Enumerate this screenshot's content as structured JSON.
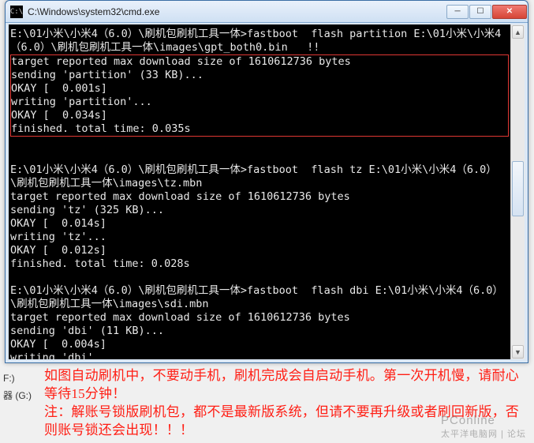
{
  "window": {
    "title": "C:\\Windows\\system32\\cmd.exe",
    "icon_label": "C:\\"
  },
  "console": {
    "block1_cmd": "E:\\01小米\\小米4（6.0）\\刷机包刷机工具一体>fastboot  flash partition E:\\01小米\\小米4（6.0）\\刷机包刷机工具一体\\images\\gpt_both0.bin   !!",
    "block1_hl": "target reported max download size of 1610612736 bytes\nsending 'partition' (33 KB)...\nOKAY [  0.001s]\nwriting 'partition'...\nOKAY [  0.034s]\nfinished. total time: 0.035s",
    "blank1": "",
    "block2": "E:\\01小米\\小米4（6.0）\\刷机包刷机工具一体>fastboot  flash tz E:\\01小米\\小米4（6.0）\\刷机包刷机工具一体\\images\\tz.mbn\ntarget reported max download size of 1610612736 bytes\nsending 'tz' (325 KB)...\nOKAY [  0.014s]\nwriting 'tz'...\nOKAY [  0.012s]\nfinished. total time: 0.028s",
    "blank2": "",
    "block3": "E:\\01小米\\小米4（6.0）\\刷机包刷机工具一体>fastboot  flash dbi E:\\01小米\\小米4（6.0）\\刷机包刷机工具一体\\images\\sdi.mbn\ntarget reported max download size of 1610612736 bytes\nsending 'dbi' (11 KB)...\nOKAY [  0.004s]\nwriting 'dbi'..."
  },
  "sidebar": {
    "item1": "F:)",
    "item2": "器 (G:)"
  },
  "note": {
    "line1": "如图自动刷机中，不要动手机，刷机完成会自启动手机。第一次开机慢，请耐心等待15分钟！",
    "line2": "注：解账号锁版刷机包，都不是最新版系统，但请不要再升级或者刷回新版，否则账号锁还会出现！！！"
  },
  "watermark": {
    "main": "PConline",
    "sub": "太平洋电脑网 | 论坛"
  }
}
